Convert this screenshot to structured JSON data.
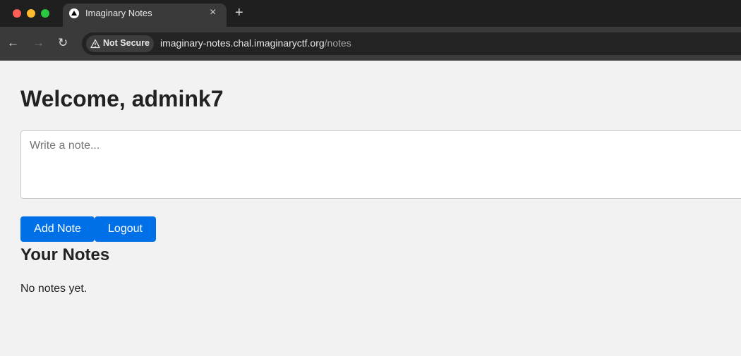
{
  "browser": {
    "tab_title": "Imaginary Notes",
    "tab_close": "×",
    "new_tab": "+",
    "nav": {
      "back": "←",
      "forward": "→",
      "reload": "↻"
    },
    "security_label": "Not Secure",
    "url_host": "imaginary-notes.chal.imaginaryctf.org",
    "url_path": "/notes"
  },
  "page": {
    "welcome": "Welcome, admink7",
    "note_placeholder": "Write a note...",
    "note_value": "",
    "add_button": "Add Note",
    "logout_button": "Logout",
    "notes_heading": "Your Notes",
    "empty_text": "No notes yet."
  },
  "colors": {
    "page_background": "#f2f2f2",
    "button_blue": "#0070e8",
    "text": "#222222"
  }
}
